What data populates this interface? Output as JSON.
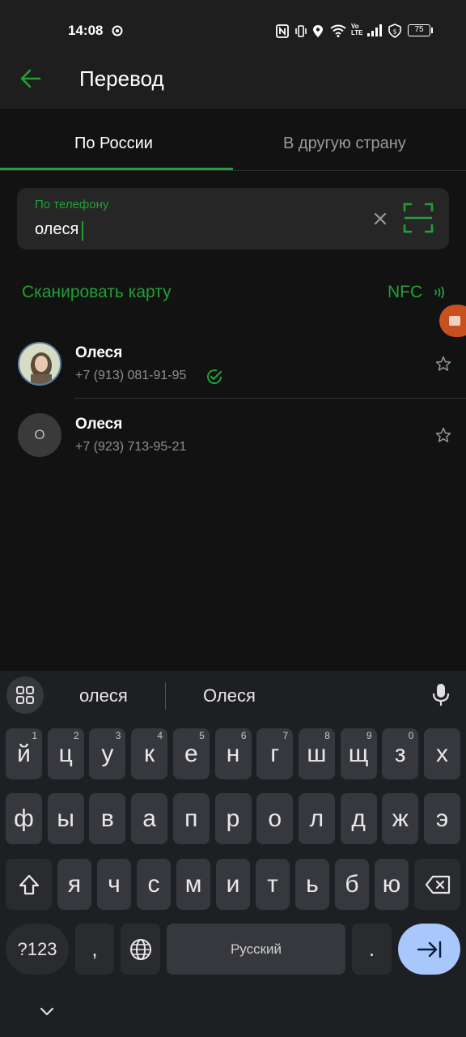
{
  "status_bar": {
    "time": "14:08",
    "battery": "75",
    "icons": [
      "video-record-icon",
      "nfc-icon",
      "vibrate-icon",
      "location-icon",
      "wifi-icon",
      "volte-icon",
      "signal-icon",
      "shield-icon",
      "battery-icon"
    ]
  },
  "app_bar": {
    "title": "Перевод",
    "back_icon": "arrow-left-icon"
  },
  "tabs": [
    {
      "label": "По России",
      "active": true
    },
    {
      "label": "В другую страну",
      "active": false
    }
  ],
  "search": {
    "label": "По телефону",
    "value": "олеся",
    "clear_icon": "close-icon",
    "scan_icon": "scan-frame-icon"
  },
  "actions": {
    "scan_card": "Сканировать карту",
    "nfc": "NFC"
  },
  "contacts": [
    {
      "name": "Олеся",
      "phone": "+7 (913) 081-91-95",
      "verified": true,
      "avatar_letter": ""
    },
    {
      "name": "Олеся",
      "phone": "+7 (923) 713-95-21",
      "verified": false,
      "avatar_letter": "О"
    }
  ],
  "keyboard": {
    "suggestions": [
      "олеся",
      "Олеся"
    ],
    "row1": [
      [
        "й",
        "1"
      ],
      [
        "ц",
        "2"
      ],
      [
        "у",
        "3"
      ],
      [
        "к",
        "4"
      ],
      [
        "е",
        "5"
      ],
      [
        "н",
        "6"
      ],
      [
        "г",
        "7"
      ],
      [
        "ш",
        "8"
      ],
      [
        "щ",
        "9"
      ],
      [
        "з",
        "0"
      ],
      [
        "х",
        ""
      ]
    ],
    "row2": [
      "ф",
      "ы",
      "в",
      "а",
      "п",
      "р",
      "о",
      "л",
      "д",
      "ж",
      "э"
    ],
    "row3": [
      "я",
      "ч",
      "с",
      "м",
      "и",
      "т",
      "ь",
      "б",
      "ю"
    ],
    "symbols_key": "?123",
    "comma_key": ",",
    "space_label": "Русский",
    "period_key": "."
  },
  "colors": {
    "accent": "#21a038",
    "background": "#121212",
    "surface": "#1e1e1e",
    "enter_key": "#a8c7fa",
    "floating_badge": "#c8501e"
  }
}
